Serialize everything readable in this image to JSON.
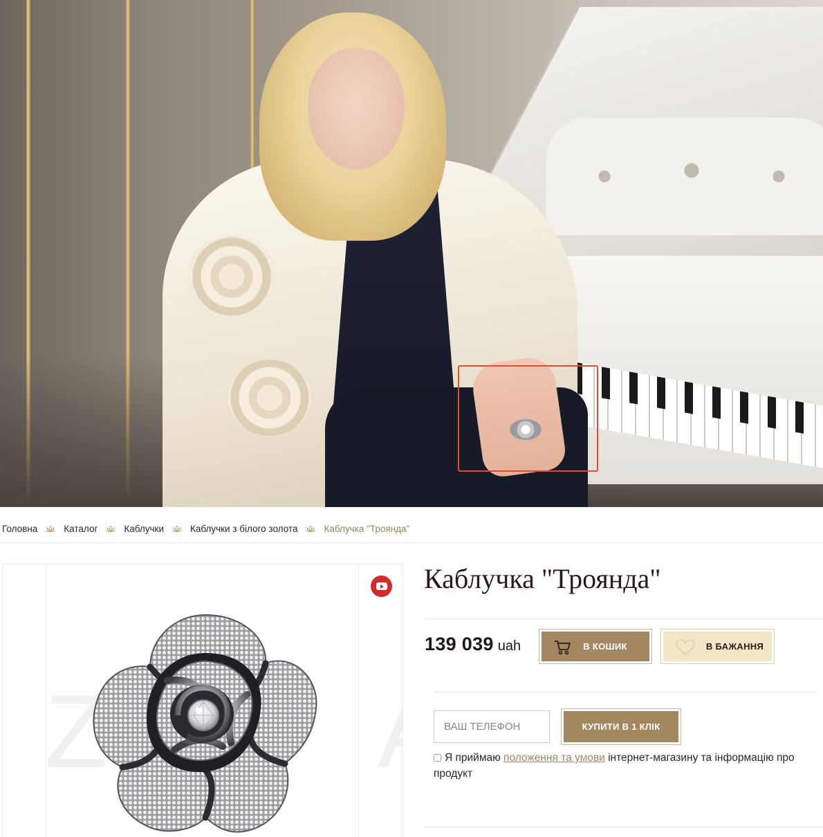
{
  "breadcrumb": {
    "items": [
      "Головна",
      "Каталог",
      "Каблучки",
      "Каблучки з білого золота"
    ],
    "current": "Каблучка \"Троянда\""
  },
  "product": {
    "title": "Каблучка \"Троянда\"",
    "price_value": "139 039",
    "price_currency": "uah",
    "watermark": "ZARINA"
  },
  "actions": {
    "cart_label": "В кошик",
    "wishlist_label": "В бажання",
    "phone_placeholder": "Ваш телефон",
    "buy_one_click_label": "Купити в 1 клік"
  },
  "terms": {
    "prefix": "Я приймаю",
    "link_text": "положення та умови",
    "suffix": "інтернет-магазину та інформацію про продукт"
  },
  "icons": {
    "video": "youtube-icon",
    "cart": "cart-icon",
    "wishlist": "heart-icon",
    "breadcrumb_separator": "lotus-icon"
  },
  "colors": {
    "accent": "#a38761",
    "accent_light": "#f3e6c6",
    "title": "#2b1a14",
    "youtube": "#d32a2a",
    "highlight": "#e2492e"
  }
}
